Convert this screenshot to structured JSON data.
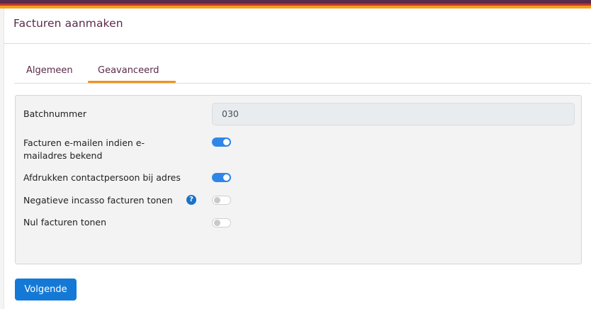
{
  "header": {
    "title": "Facturen aanmaken"
  },
  "tabs": [
    {
      "label": "Algemeen",
      "active": false
    },
    {
      "label": "Geavanceerd",
      "active": true
    }
  ],
  "form": {
    "batch_label": "Batchnummer",
    "batch_value": "030",
    "email_label": "Facturen e-mailen indien e-mailadres bekend",
    "email_on": true,
    "print_label": "Afdrukken contactpersoon bij adres",
    "print_on": true,
    "negative_label": "Negatieve incasso facturen tonen",
    "negative_help": "?",
    "negative_on": false,
    "zero_label": "Nul facturen tonen",
    "zero_on": false
  },
  "footer": {
    "next_label": "Volgende"
  },
  "colors": {
    "brand": "#5b2a4a",
    "accent": "#f0921e",
    "primary": "#1479d6"
  }
}
